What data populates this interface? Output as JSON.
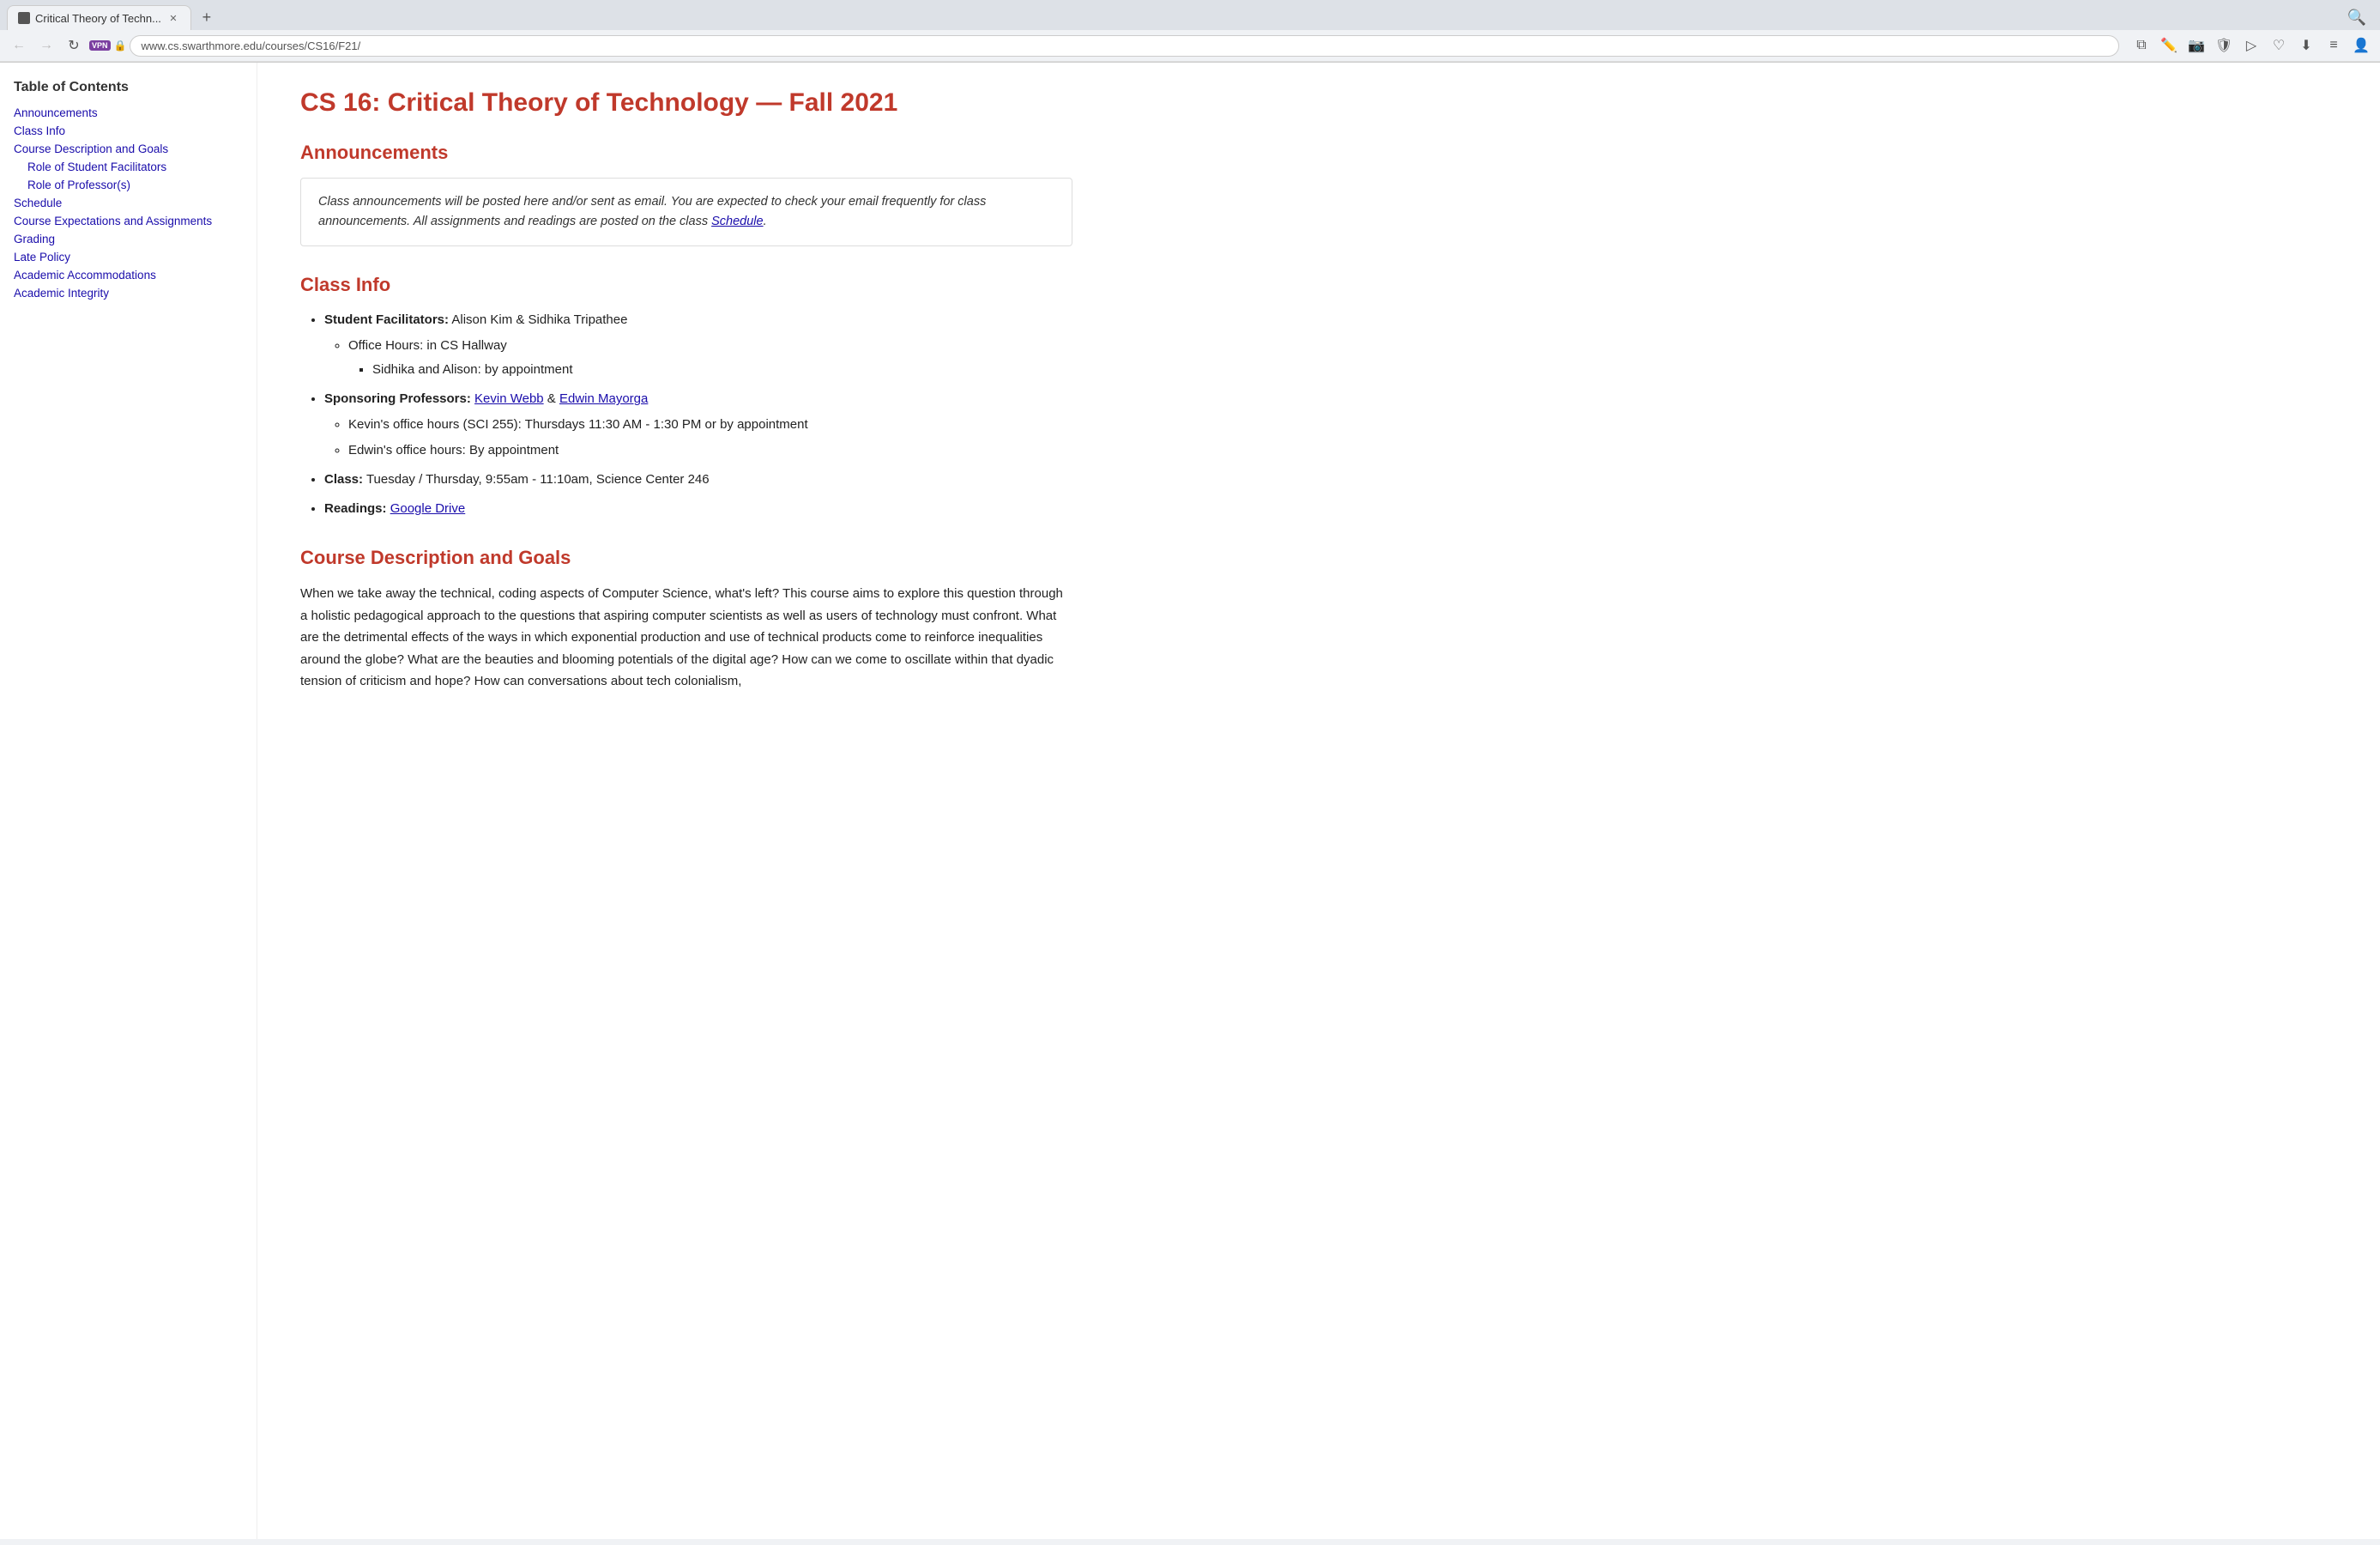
{
  "browser": {
    "tab_title": "Critical Theory of Techn...",
    "tab_new_label": "+",
    "address": "www.cs.swarthmore.edu/courses/CS16/F21/",
    "address_display": "www.cs.swarthmore.edu/courses/CS16/F21/"
  },
  "sidebar": {
    "toc_title": "Table of Contents",
    "items": [
      {
        "label": "Announcements",
        "id": "announcements"
      },
      {
        "label": "Class Info",
        "id": "classinfo"
      },
      {
        "label": "Course Description and Goals",
        "id": "coursedesc"
      },
      {
        "label": "Role of Student Facilitators",
        "id": "rolestudent",
        "sub": true
      },
      {
        "label": "Role of Professor(s)",
        "id": "roleprof",
        "sub": true
      },
      {
        "label": "Schedule",
        "id": "schedule"
      },
      {
        "label": "Course Expectations and Assignments",
        "id": "expectations"
      },
      {
        "label": "Grading",
        "id": "grading"
      },
      {
        "label": "Late Policy",
        "id": "latepolicy"
      },
      {
        "label": "Academic Accommodations",
        "id": "accommodations"
      },
      {
        "label": "Academic Integrity",
        "id": "integrity"
      }
    ]
  },
  "main": {
    "page_title": "CS 16: Critical Theory of Technology — Fall 2021",
    "sections": {
      "announcements": {
        "heading": "Announcements",
        "box_text_before": "Class announcements will be posted here and/or sent as email. You are expected to check your email frequently for class announcements. All assignments and readings are posted on the class ",
        "schedule_link": "Schedule",
        "box_text_after": "."
      },
      "classinfo": {
        "heading": "Class Info",
        "facilitators_label": "Student Facilitators:",
        "facilitators_value": "Alison Kim & Sidhika Tripathee",
        "office_hours_label": "Office Hours: in CS Hallway",
        "appt_label": "Sidhika and Alison: by appointment",
        "professors_label": "Sponsoring Professors:",
        "professor1_name": "Kevin Webb",
        "professor_and": "&",
        "professor2_name": "Edwin Mayorga",
        "kevin_hours": "Kevin's office hours (SCI 255): Thursdays 11:30 AM - 1:30 PM or by appointment",
        "edwin_hours": "Edwin's office hours: By appointment",
        "class_label": "Class:",
        "class_value": "Tuesday / Thursday, 9:55am - 11:10am, Science Center 246",
        "readings_label": "Readings:",
        "readings_link": "Google Drive"
      },
      "coursedesc": {
        "heading": "Course Description and Goals",
        "text": "When we take away the technical, coding aspects of Computer Science, what's left? This course aims to explore this question through a holistic pedagogical approach to the questions that aspiring computer scientists as well as users of technology must confront. What are the detrimental effects of the ways in which exponential production and use of technical products come to reinforce inequalities around the globe? What are the beauties and blooming potentials of the digital age? How can we come to oscillate within that dyadic tension of criticism and hope? How can conversations about tech colonialism,"
      }
    }
  }
}
